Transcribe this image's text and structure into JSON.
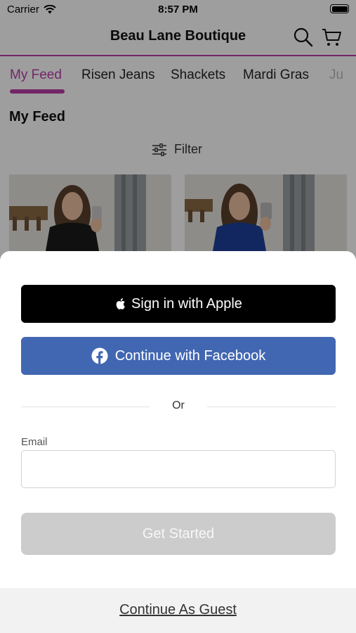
{
  "status_bar": {
    "carrier": "Carrier",
    "time": "8:57 PM"
  },
  "navbar": {
    "title": "Beau Lane Boutique",
    "icons": [
      "search-icon",
      "cart-icon"
    ]
  },
  "tabs": [
    {
      "label": "My Feed",
      "active": true
    },
    {
      "label": "Risen Jeans",
      "active": false
    },
    {
      "label": "Shackets",
      "active": false
    },
    {
      "label": "Mardi Gras",
      "active": false
    },
    {
      "label": "Ju",
      "active": false
    }
  ],
  "feed": {
    "title": "My Feed",
    "filter_label": "Filter"
  },
  "colors": {
    "accent": "#b93da8",
    "facebook": "#4267b2",
    "apple": "#000000",
    "disabled": "#cccccc"
  },
  "sheet": {
    "apple_label": "Sign in with Apple",
    "facebook_label": "Continue with Facebook",
    "or_label": "Or",
    "email_label": "Email",
    "email_value": "",
    "email_placeholder": "",
    "get_started_label": "Get Started",
    "guest_label": "Continue As Guest"
  }
}
